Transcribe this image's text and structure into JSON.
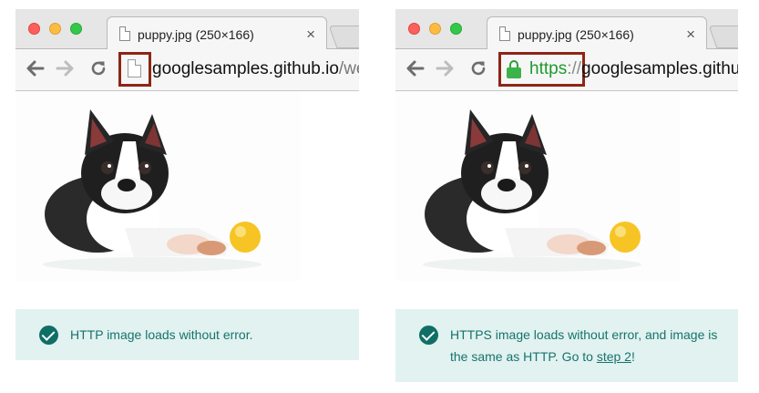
{
  "left": {
    "tab": {
      "title": "puppy.jpg (250×166)",
      "close": "×"
    },
    "address": {
      "host": "googlesamples.github.io",
      "path": "/we"
    },
    "message": {
      "text": "HTTP image loads without error."
    }
  },
  "right": {
    "tab": {
      "title": "puppy.jpg (250×166)",
      "close": "×"
    },
    "address": {
      "scheme": "https",
      "separator": "://",
      "host": "googlesamples.githu"
    },
    "message": {
      "before_link": "HTTPS image loads without error, and image is the same as HTTP. Go to ",
      "link": "step 2",
      "after_link": "!"
    }
  },
  "icons": [
    "back-arrow-icon",
    "forward-arrow-icon",
    "reload-icon",
    "page-icon",
    "lock-icon",
    "close-icon",
    "check-icon"
  ],
  "colors": {
    "highlight": "#8c2616",
    "secure_green": "#1f9a2e",
    "status_bg": "#e1f2f1",
    "status_text": "#17736b",
    "check": "#0f6f66"
  }
}
